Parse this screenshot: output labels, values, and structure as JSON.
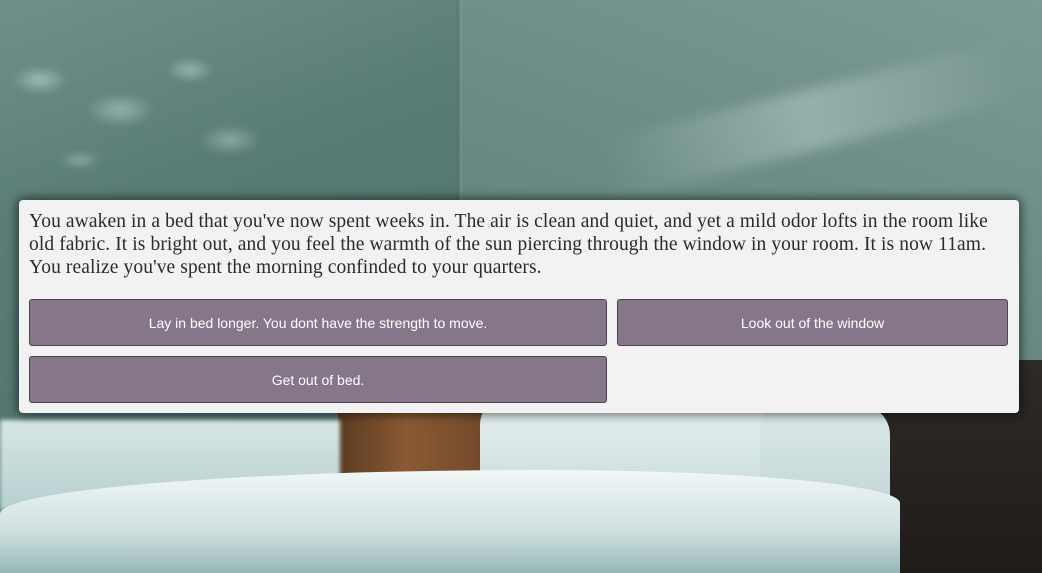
{
  "story": {
    "text": "You awaken in a bed that you've now spent weeks in. The air is clean and quiet, and yet a mild odor lofts in the room like old fabric. It is bright out, and you feel the warmth of the sun piercing through the window in your room. It is now 11am. You realize you've spent the morning confinded to your quarters."
  },
  "choices": [
    {
      "label": "Lay in bed longer. You dont have the strength to move."
    },
    {
      "label": "Look out of the window"
    },
    {
      "label": "Get out of bed."
    }
  ],
  "colors": {
    "panel_background": "#f3f2f3",
    "button_background": "#857689",
    "button_text": "#ffffff"
  }
}
